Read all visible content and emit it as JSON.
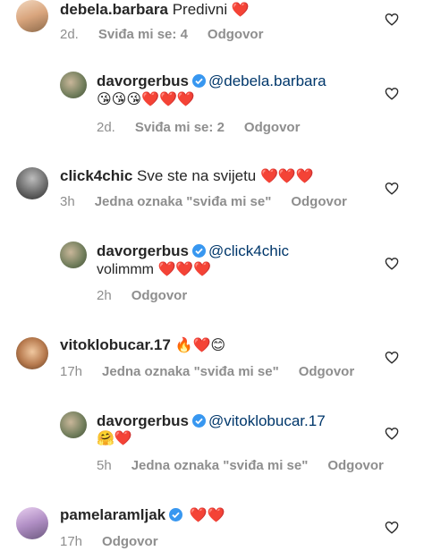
{
  "comments": [
    {
      "username": "debela.barbara",
      "text": "Predivni",
      "emoji": "❤️",
      "time": "2d.",
      "likes": "Sviđa mi se: 4",
      "reply": "Odgovor"
    },
    {
      "username": "davorgerbus",
      "mention": "@debela.barbara",
      "text": "😘😘😘❤️❤️❤️",
      "time": "2d.",
      "likes": "Sviđa mi se: 2",
      "reply": "Odgovor"
    },
    {
      "username": "click4chic",
      "text": "Sve ste na svijetu",
      "emoji": "❤️❤️❤️",
      "time": "3h",
      "likes": "Jedna oznaka \"sviđa mi se\"",
      "reply": "Odgovor"
    },
    {
      "username": "davorgerbus",
      "mention": "@click4chic",
      "text": "volimmm ❤️❤️❤️",
      "time": "2h",
      "reply": "Odgovor"
    },
    {
      "username": "vitoklobucar.17",
      "emoji": "🔥❤️😊",
      "time": "17h",
      "likes": "Jedna oznaka \"sviđa mi se\"",
      "reply": "Odgovor"
    },
    {
      "username": "davorgerbus",
      "mention": "@vitoklobucar.17",
      "text": "🤗❤️",
      "time": "5h",
      "likes": "Jedna oznaka \"sviđa mi se\"",
      "reply": "Odgovor"
    },
    {
      "username": "pamelaramljak",
      "emoji": "❤️❤️",
      "time": "17h",
      "reply": "Odgovor"
    }
  ],
  "colors": {
    "verified": "#3897f0",
    "meta": "#8e8e8e",
    "mention": "#00376b"
  },
  "icons": {
    "like": "heart-outline-icon",
    "verified": "verified-badge-icon"
  }
}
